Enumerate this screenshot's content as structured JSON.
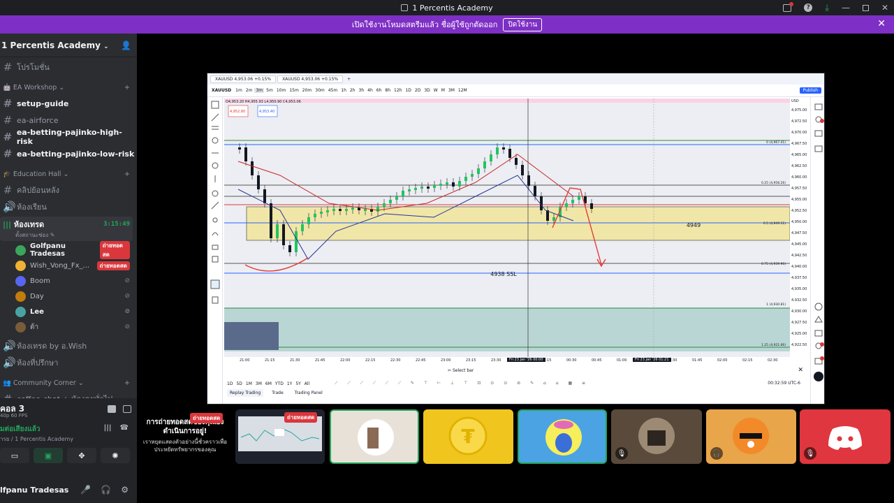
{
  "titlebar": {
    "title": "1 Percentis Academy"
  },
  "banner": {
    "text": "เปิดใช้งานโหมดสตรีมแล้ว ชื่อผู้ใช้ถูกตัดออก",
    "button": "ปิดใช้งาน"
  },
  "server": {
    "name": "1 Percentis Academy",
    "channels_top": [
      {
        "name": "โปรโมชั่น"
      }
    ],
    "categories": [
      {
        "name": "EA Workshop",
        "channels": [
          {
            "name": "setup-guide",
            "bright": true
          },
          {
            "name": "ea-airforce",
            "bright": false
          },
          {
            "name": "ea-betting-pajinko-high-risk",
            "bright": true
          },
          {
            "name": "ea-betting-pajinko-low-risk",
            "bright": true
          }
        ]
      },
      {
        "name": "Education Hall",
        "channels": [
          {
            "name": "คลิปย้อนหลัง"
          },
          {
            "name": "ห้องเรียน"
          }
        ]
      }
    ],
    "active_voice": {
      "name": "ห้องเทรด",
      "timer": "3:15:49",
      "status": "ตั้งสถานะช่อง"
    },
    "voice_users": [
      {
        "name": "Golfpanu Tradesas",
        "badge": "ถ่ายทอดสด",
        "color": "#3ba55c",
        "bold": true
      },
      {
        "name": "Wish_Vong_Fx_...",
        "badge": "ถ่ายทอดสด",
        "color": "#f0b232",
        "bold": false
      },
      {
        "name": "Boom",
        "badge": "",
        "color": "#5865f2",
        "bold": false
      },
      {
        "name": "Day",
        "badge": "",
        "color": "#c27c0e",
        "bold": false
      },
      {
        "name": "Lee",
        "badge": "",
        "color": "#4aa3a3",
        "bold": true
      },
      {
        "name": "ต้า",
        "badge": "",
        "color": "#7a5c3a",
        "bold": false
      }
    ],
    "more_channels": [
      {
        "name": "ห้องเทรด by อ.Wish"
      },
      {
        "name": "ห้องที่ปรึกษา"
      }
    ],
    "community": {
      "name": "Community Corner",
      "first": "coffee-chat + ห้องคุยทั่วไป"
    }
  },
  "call": {
    "name": "คอล 3",
    "sub": "40p 60 FPS",
    "connected": "มต่อเสียงแล้ว",
    "connected_sub": "ารย / 1 Percentis Academy"
  },
  "user": {
    "name": "lfpanu Tradesas"
  },
  "tradingview": {
    "tabs": [
      "XAUUSD  4,953.06 +0.15%",
      "XAUUSD  4,953.06 +0.15%"
    ],
    "symbol": "XAUUSD",
    "timeframes": [
      "1m",
      "2m",
      "3m",
      "5m",
      "10m",
      "15m",
      "20m",
      "30m",
      "45m",
      "1h",
      "2h",
      "3h",
      "4h",
      "6h",
      "8h",
      "12h",
      "1D",
      "2D",
      "3D",
      "W",
      "M",
      "3M",
      "12M"
    ],
    "publish": "Publish",
    "trade": "Trade",
    "ohlc": "O4,953.20 H4,955.93 L4,950.90 C4,953.06",
    "sell_price": "4,952.80",
    "buy_price": "4,953.40",
    "labels": {
      "ssl": "4938 SSL",
      "level": "4949"
    },
    "fib": [
      "0 (4,967.41)",
      "0.25 (4,958.26)",
      "0.5 (4,949.11)",
      "0.75 (4,939.96)",
      "1 (4,930.81)",
      "1.25 (4,921.66)"
    ],
    "price_ticks": [
      "4,975.00",
      "4,972.50",
      "4,970.00",
      "4,967.50",
      "4,965.00",
      "4,962.50",
      "4,960.00",
      "4,957.50",
      "4,955.00",
      "4,952.50",
      "4,950.00",
      "4,947.50",
      "4,945.00",
      "4,942.50",
      "4,940.00",
      "4,937.50",
      "4,935.00",
      "4,932.50",
      "4,930.00",
      "4,927.50",
      "4,925.00",
      "4,922.50"
    ],
    "time_ticks": [
      "21:00",
      "21:15",
      "21:30",
      "21:45",
      "22:00",
      "22:15",
      "22:30",
      "22:45",
      "23:00",
      "23:15",
      "23:30",
      "23:45",
      "00:15",
      "00:30",
      "00:45",
      "01:00",
      "01:15",
      "01:30",
      "01:45",
      "02:00",
      "02:15",
      "02:30"
    ],
    "time_marker_a": "Fri 23 Jan '26  00:00",
    "time_marker_b": "Fri 23 Jan '26  01:21",
    "ranges": [
      "1D",
      "5D",
      "1M",
      "3M",
      "6M",
      "YTD",
      "1Y",
      "5Y",
      "All"
    ],
    "bottom_tabs": [
      "Replay Trading",
      "Trade",
      "Trading Panel"
    ],
    "select_bar": "Select bar",
    "clock": "00:32:59 UTC-6",
    "currency": "USD"
  },
  "stream_tiles": {
    "live_badge": "ถ่ายทอดสด",
    "message_title": "การถ่ายทอดสดของคุณยังดำเนินการอยู่!",
    "message_body": "เราหยุดแสดงตัวอย่างนี้ชั่วคราวเพื่อประหยัดทรัพยากรของคุณ"
  }
}
